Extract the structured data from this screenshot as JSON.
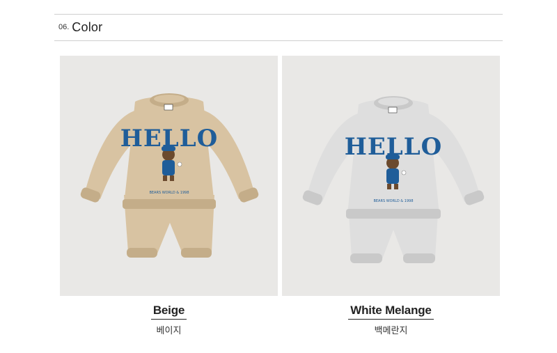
{
  "section": {
    "number": "06.",
    "title": "Color"
  },
  "colors": {
    "accent_blue": "#1f5d99",
    "beige": "#d8c3a2",
    "white_melange": "#dcdcdc"
  },
  "variants": [
    {
      "name_en": "Beige",
      "name_ko": "베이지",
      "garment_text": "HELLO",
      "small_print": "BEARS WORLD & 1998",
      "garment_color": "#d8c3a2",
      "garment_shade": "#c4ad89"
    },
    {
      "name_en": "White Melange",
      "name_ko": "백메란지",
      "garment_text": "HELLO",
      "small_print": "BEARS WORLD & 1998",
      "garment_color": "#dedede",
      "garment_shade": "#c9c9c9"
    }
  ]
}
